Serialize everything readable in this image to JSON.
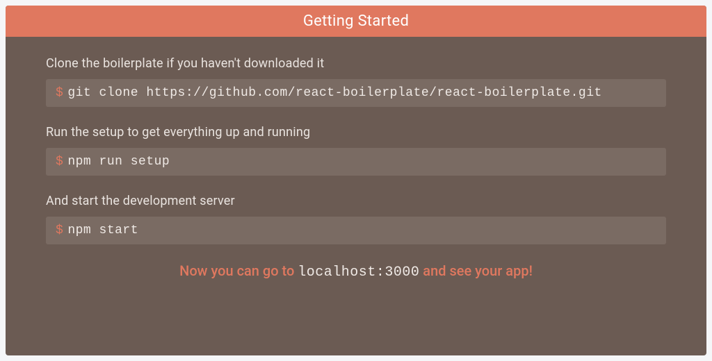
{
  "header": {
    "title": "Getting Started"
  },
  "steps": [
    {
      "label": "Clone the boilerplate if you haven't downloaded it",
      "prompt": "$",
      "command": "git clone https://github.com/react-boilerplate/react-boilerplate.git"
    },
    {
      "label": "Run the setup to get everything up and running",
      "prompt": "$",
      "command": "npm run setup"
    },
    {
      "label": "And start the development server",
      "prompt": "$",
      "command": "npm start"
    }
  ],
  "footer": {
    "prefix": "Now you can go to ",
    "url": "localhost:3000",
    "suffix": " and see your app!"
  }
}
